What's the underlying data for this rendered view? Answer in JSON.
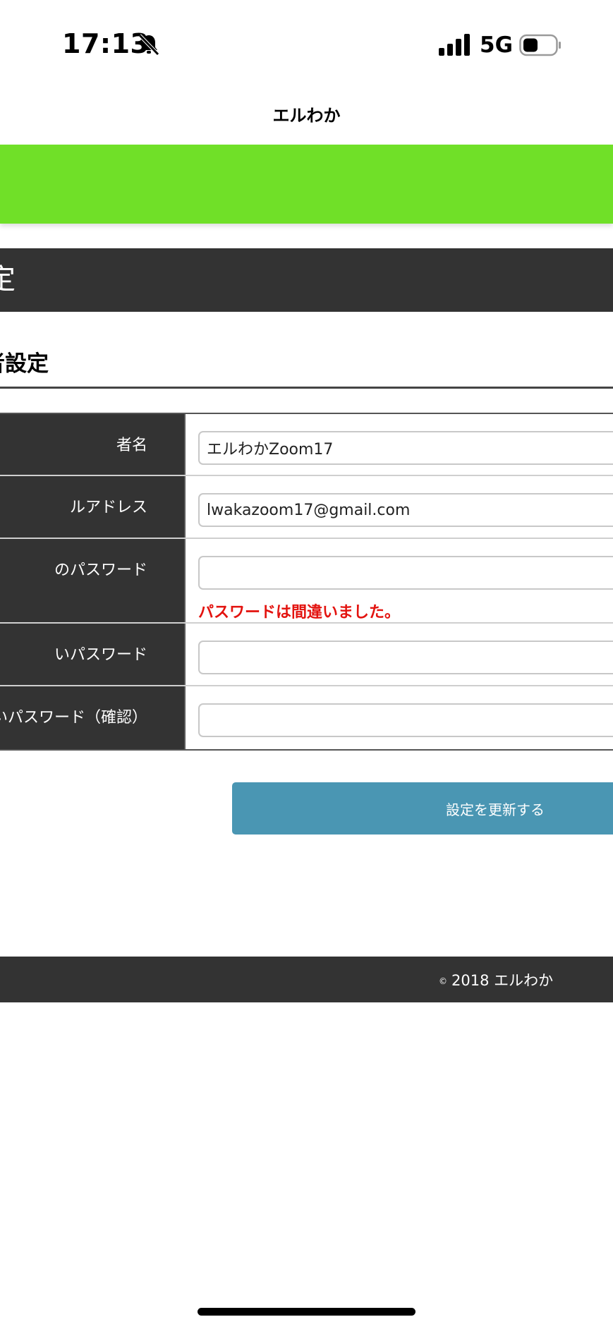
{
  "status_bar": {
    "time": "17:13",
    "network": "5G"
  },
  "nav": {
    "title": "エルわか"
  },
  "page_header": {
    "title": "定"
  },
  "section": {
    "title": "者設定"
  },
  "form": {
    "rows": [
      {
        "label": "者名",
        "value": "エルわかZoom17",
        "placeholder": ""
      },
      {
        "label": "ルアドレス",
        "value": "lwakazoom17@gmail.com",
        "placeholder": ""
      },
      {
        "label": "のパスワード",
        "value": "",
        "placeholder": "",
        "error": "パスワードは間違いました。"
      },
      {
        "label": "いパスワード",
        "value": "",
        "placeholder": ""
      },
      {
        "label": "いパスワード（確認）",
        "value": "",
        "placeholder": ""
      }
    ]
  },
  "submit": {
    "label": "設定を更新する"
  },
  "footer": {
    "copyright_symbol": "©",
    "text": "2018 エルわか"
  },
  "colors": {
    "banner": "#70e028",
    "dark": "#333333",
    "button": "#4a96b3",
    "error": "#e3130f"
  },
  "icons": [
    "bell-slash-icon",
    "signal-icon",
    "battery-icon"
  ]
}
